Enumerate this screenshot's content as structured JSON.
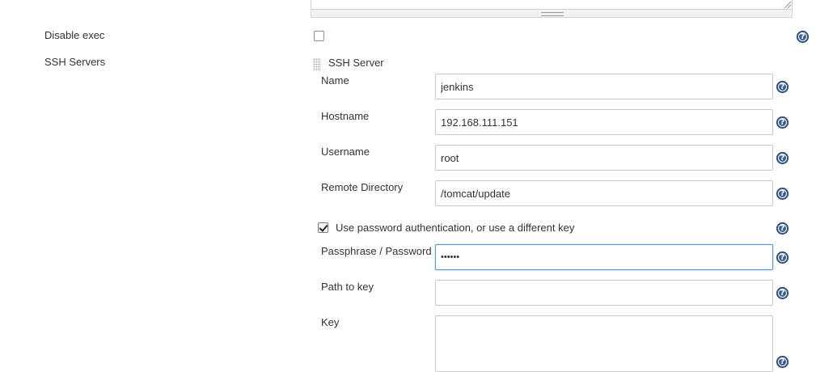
{
  "options": {
    "disable_exec_label": "Disable exec",
    "disable_exec_checked": false,
    "ssh_servers_label": "SSH Servers"
  },
  "ssh_server": {
    "title": "SSH Server",
    "name": {
      "label": "Name",
      "value": "jenkins"
    },
    "hostname": {
      "label": "Hostname",
      "value": "192.168.111.151"
    },
    "username": {
      "label": "Username",
      "value": "root"
    },
    "remote_directory": {
      "label": "Remote Directory",
      "value": "/tomcat/update"
    },
    "use_password_auth": {
      "label": "Use password authentication, or use a different key",
      "checked": true
    },
    "passphrase": {
      "label": "Passphrase / Password",
      "masked_value": "••••••"
    },
    "path_to_key": {
      "label": "Path to key",
      "value": ""
    },
    "key": {
      "label": "Key",
      "value": ""
    }
  },
  "icons": {
    "help": "help-icon",
    "help_glyph": "?",
    "drag": "drag-handle-icon"
  },
  "colors": {
    "help_icon": "#3b5f8f",
    "focus_border": "#5b9bd5",
    "text": "#333333"
  }
}
